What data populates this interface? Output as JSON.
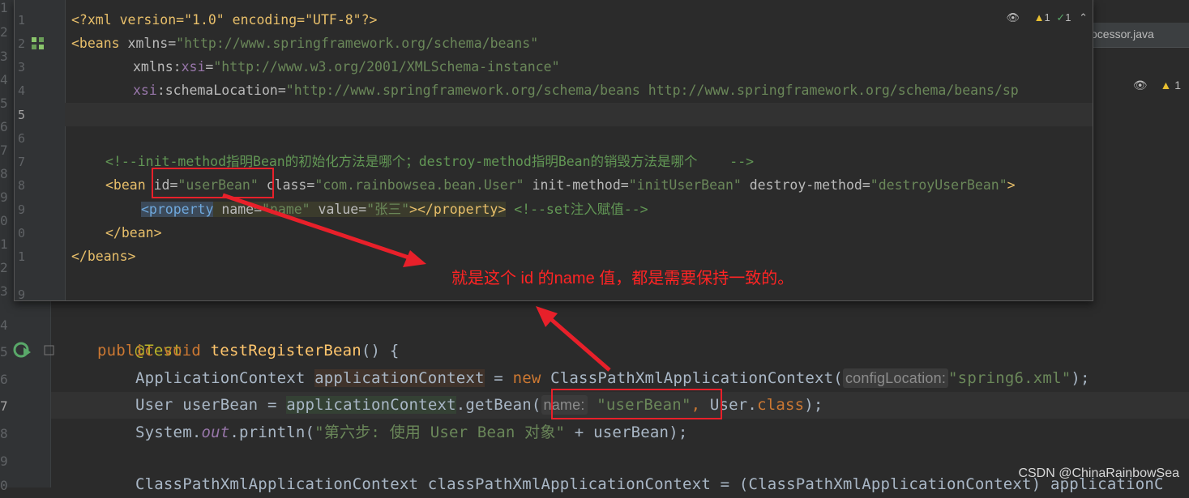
{
  "background_editor": {
    "tab_label": "ocessor.java",
    "status": {
      "warnings": "1"
    },
    "line_numbers": [
      "1",
      "2",
      "3",
      "4",
      "5",
      "6",
      "7",
      "8",
      "9",
      "0",
      "1",
      "2",
      "3",
      "4",
      "5",
      "6",
      "7",
      "8",
      "9",
      "0",
      "1",
      "2",
      "3",
      "4",
      "5",
      "6"
    ],
    "code": {
      "annotation": "@Test",
      "method_modifiers": "public void ",
      "method_name": "testRegisterBean",
      "method_tail": "() {",
      "l1_type": "ApplicationContext ",
      "l1_var": "applicationContext",
      "l1_eq": " = ",
      "l1_new": "new ",
      "l1_class": "ClassPathXmlApplicationContext(",
      "l1_hint": "configLocation:",
      "l1_arg": "\"spring6.xml\"",
      "l1_end": ");",
      "l2_start": "User userBean = ",
      "l2_ctx": "applicationContext",
      "l2_call": ".getBean(",
      "l2_hint": "name:",
      "l2_arg": "\"userBean\"",
      "l2_comma": ", ",
      "l2_cls": "User.",
      "l2_kw": "class",
      "l2_end": ");",
      "l3_sys": "System.",
      "l3_out": "out",
      "l3_println": ".println(",
      "l3_str": "\"第六步: 使用 User Bean 对象\"",
      "l3_end": " + userBean);",
      "l5_partial": "ClassPathXmlApplicationContext classPathXmlApplicationContext = (ClassPathXmlApplicationContext) applicationC"
    }
  },
  "popup": {
    "line_numbers": [
      "1",
      "2",
      "3",
      "4",
      "5",
      "6",
      "7",
      "8",
      "9",
      "0",
      "1",
      "9"
    ],
    "status": {
      "warnings": "1",
      "ok": "1"
    },
    "xml": {
      "pi": "<?xml version=\"1.0\" encoding=\"UTF-8\"?>",
      "beans_open_tag": "<beans",
      "xmlns_attr": " xmlns",
      "xmlns_val": "\"http://www.springframework.org/schema/beans\"",
      "xsi_prefix": "xmlns:",
      "xsi_name": "xsi",
      "xsi_val": "\"http://www.w3.org/2001/XMLSchema-instance\"",
      "schema_ns": "xsi",
      "schema_attr": ":schemaLocation=",
      "schema_val": "\"http://www.springframework.org/schema/beans http://www.springframework.org/schema/beans/sp",
      "comment": "<!--init-method指明Bean的初始化方法是哪个；destroy-method指明Bean的销毁方法是哪个    -->",
      "bean_tag": "<bean",
      "id_attr": " id=",
      "id_val": "\"userBean\"",
      "class_attr": " class=",
      "class_val": "\"com.rainbowsea.bean.User\"",
      "init_attr": " init-method=",
      "init_val": "\"initUserBean\"",
      "destroy_attr": " destroy-method=",
      "destroy_val": "\"destroyUserBean\"",
      "bean_close": ">",
      "property_tag": "<property",
      "name_attr": " name=",
      "name_val": "\"name\"",
      "value_attr": " value=",
      "value_val": "\"张三\"",
      "property_close": "></property>",
      "property_comment": " <!--set注入赋值-->",
      "bean_end": "</bean>",
      "beans_end": "</beans>"
    }
  },
  "annotation_text": "就是这个 id 的name 值，都是需要保持一致的。",
  "watermark": "CSDN @ChinaRainbowSea",
  "colors": {
    "annotation_red": "#ff2424",
    "arrow_red": "#e8202a"
  }
}
